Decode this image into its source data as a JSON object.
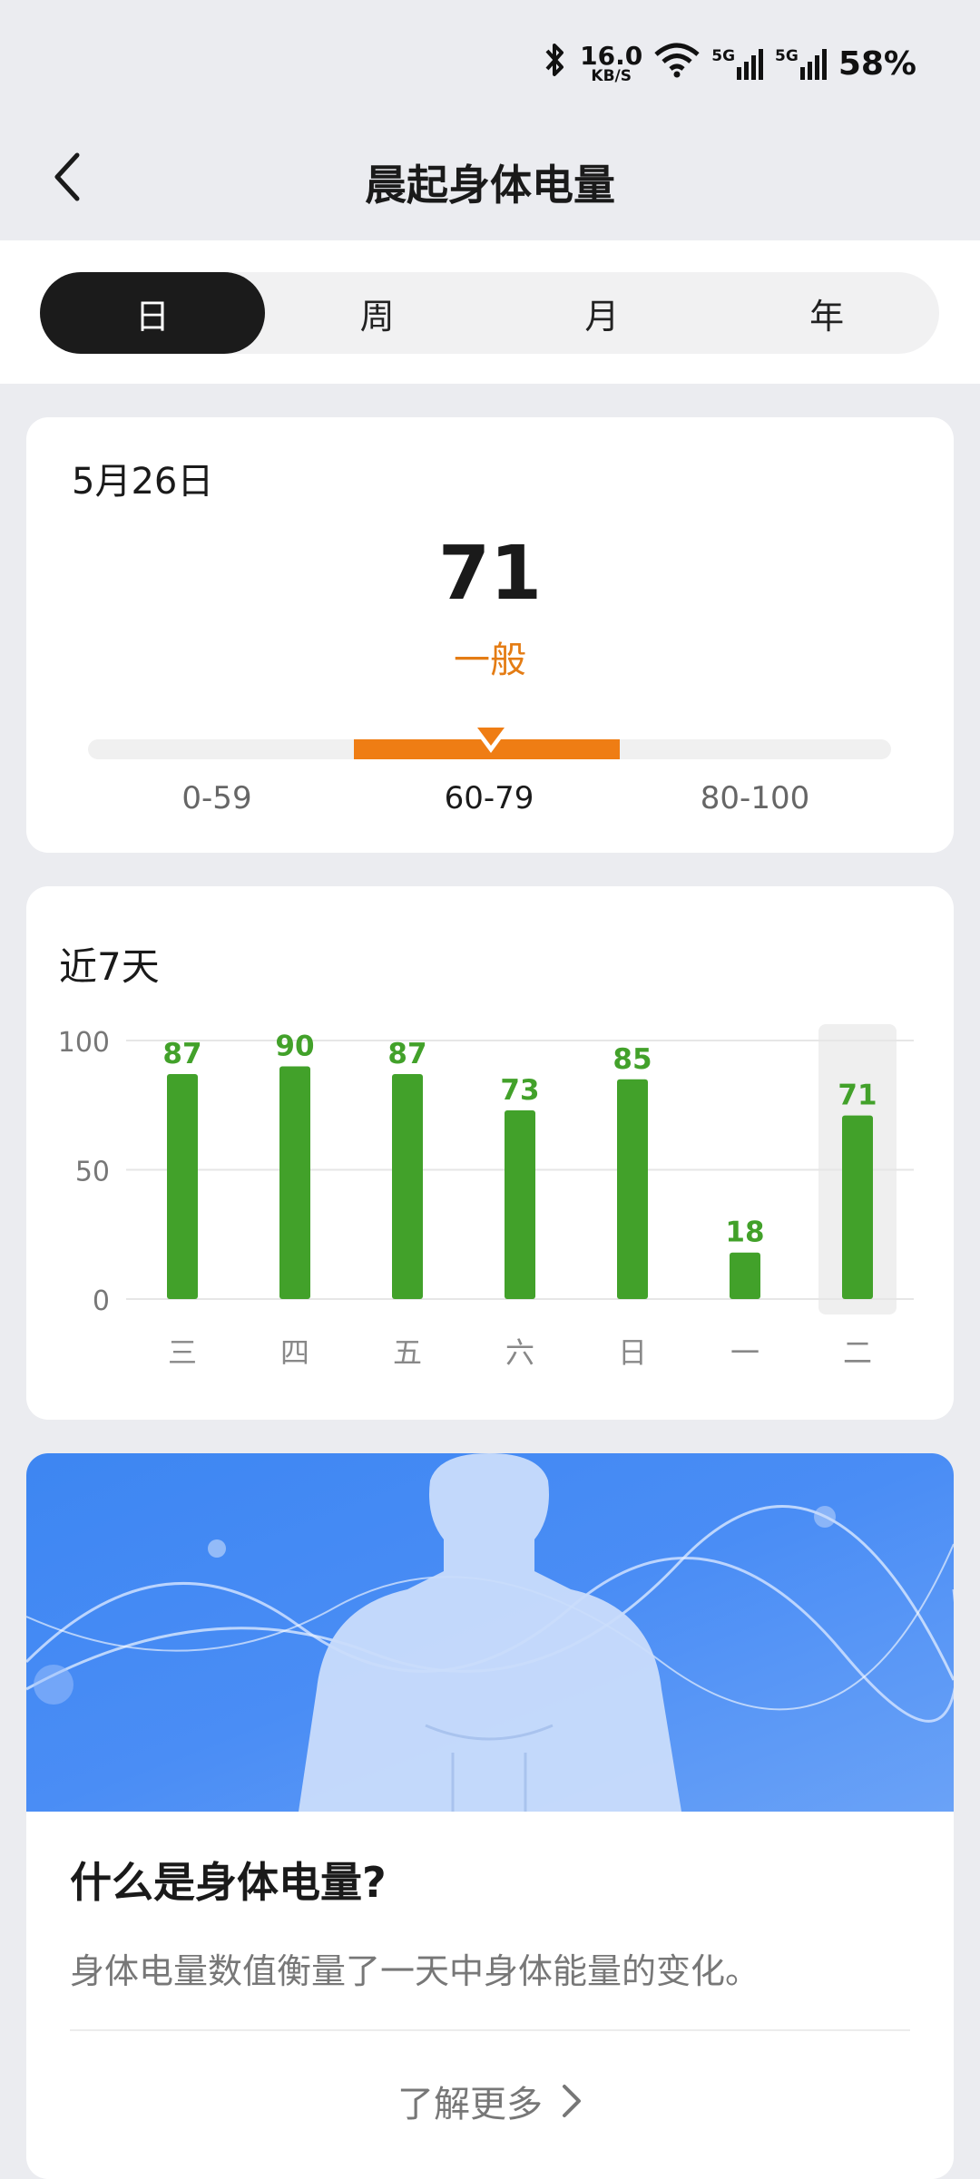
{
  "status": {
    "speed_value": "16.0",
    "speed_unit": "KB/S",
    "signal1": "5G",
    "signal2": "5G",
    "battery": "58%"
  },
  "header": {
    "title": "晨起身体电量"
  },
  "tabs": [
    {
      "label": "日",
      "active": true
    },
    {
      "label": "周",
      "active": false
    },
    {
      "label": "月",
      "active": false
    },
    {
      "label": "年",
      "active": false
    }
  ],
  "summary": {
    "date": "5月26日",
    "score": "71",
    "level": "一般",
    "ranges": [
      "0-59",
      "60-79",
      "80-100"
    ],
    "accent": "#ef7d14"
  },
  "chart_data": {
    "type": "bar",
    "title": "近7天",
    "categories": [
      "三",
      "四",
      "五",
      "六",
      "日",
      "一",
      "二"
    ],
    "values": [
      87,
      90,
      87,
      73,
      85,
      18,
      71
    ],
    "yticks": [
      100,
      50,
      0
    ],
    "ylim": [
      0,
      100
    ],
    "highlighted_index": 6,
    "bar_color": "#42a12a",
    "grid": true
  },
  "info": {
    "question": "什么是身体电量?",
    "description": "身体电量数值衡量了一天中身体能量的变化。",
    "more_label": "了解更多"
  }
}
